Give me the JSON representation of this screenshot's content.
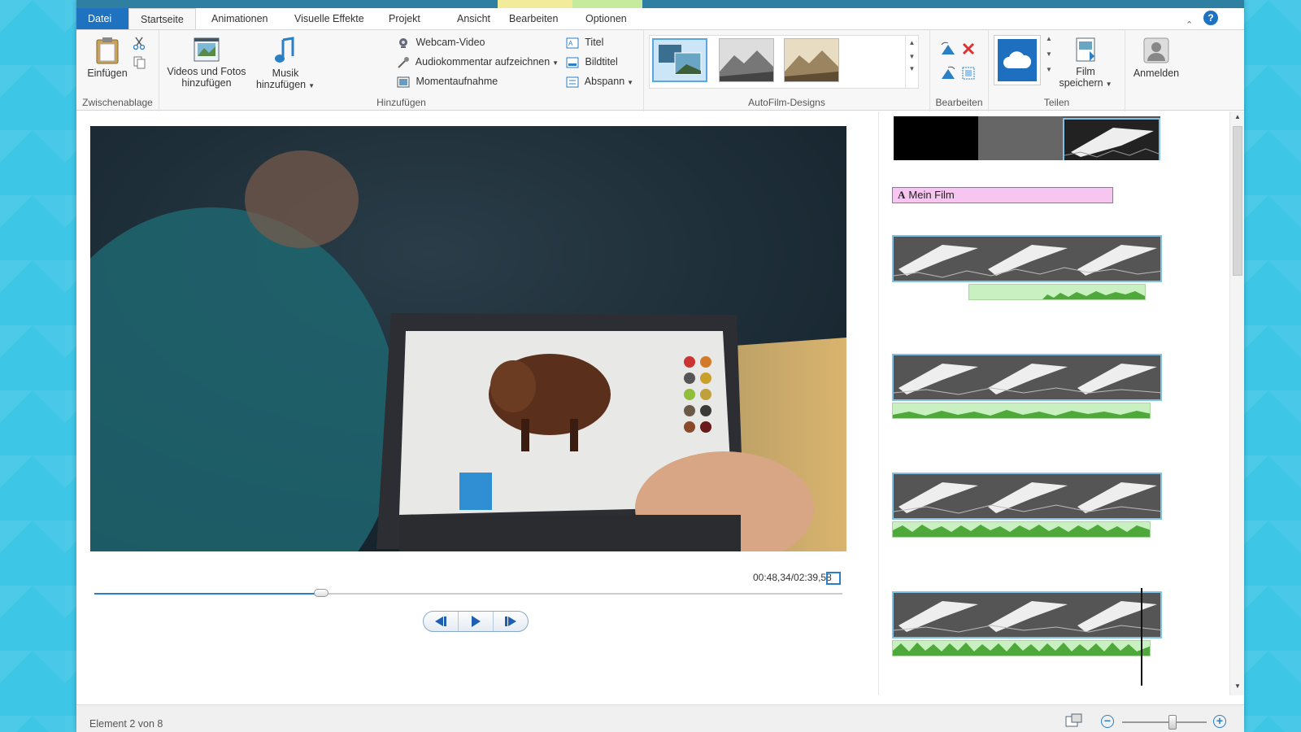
{
  "tabs": {
    "file": "Datei",
    "home": "Startseite",
    "animations": "Animationen",
    "visual_effects": "Visuelle Effekte",
    "project": "Projekt",
    "view": "Ansicht",
    "edit": "Bearbeiten",
    "options": "Optionen"
  },
  "ribbon": {
    "clipboard": {
      "label": "Zwischenablage",
      "paste": "Einfügen"
    },
    "add": {
      "label": "Hinzufügen",
      "videos_photos_line1": "Videos und Fotos",
      "videos_photos_line2": "hinzufügen",
      "music_line1": "Musik",
      "music_line2": "hinzufügen",
      "webcam": "Webcam-Video",
      "narration": "Audiokommentar aufzeichnen",
      "snapshot": "Momentaufnahme",
      "title": "Titel",
      "caption": "Bildtitel",
      "credits": "Abspann"
    },
    "autofilm": {
      "label": "AutoFilm-Designs"
    },
    "edit": {
      "label": "Bearbeiten"
    },
    "share": {
      "label": "Teilen",
      "save_line1": "Film",
      "save_line2": "speichern"
    },
    "signin": {
      "label": "Anmelden"
    }
  },
  "preview": {
    "timecode": "00:48,34/02:39,58",
    "progress": 0.303
  },
  "storyboard": {
    "title_clip": "Mein Film"
  },
  "status": {
    "text": "Element 2 von 8",
    "zoom_level": 0.6
  },
  "colors": {
    "accent": "#1e72c0",
    "title_strip": "#2f7fa2",
    "clip_border": "#7ec3e6",
    "title_clip_bg": "#f6c6f0",
    "audio_wave": "#4fa83a",
    "context_yellow": "#f2ec9a",
    "context_green": "#c7eb9d"
  }
}
